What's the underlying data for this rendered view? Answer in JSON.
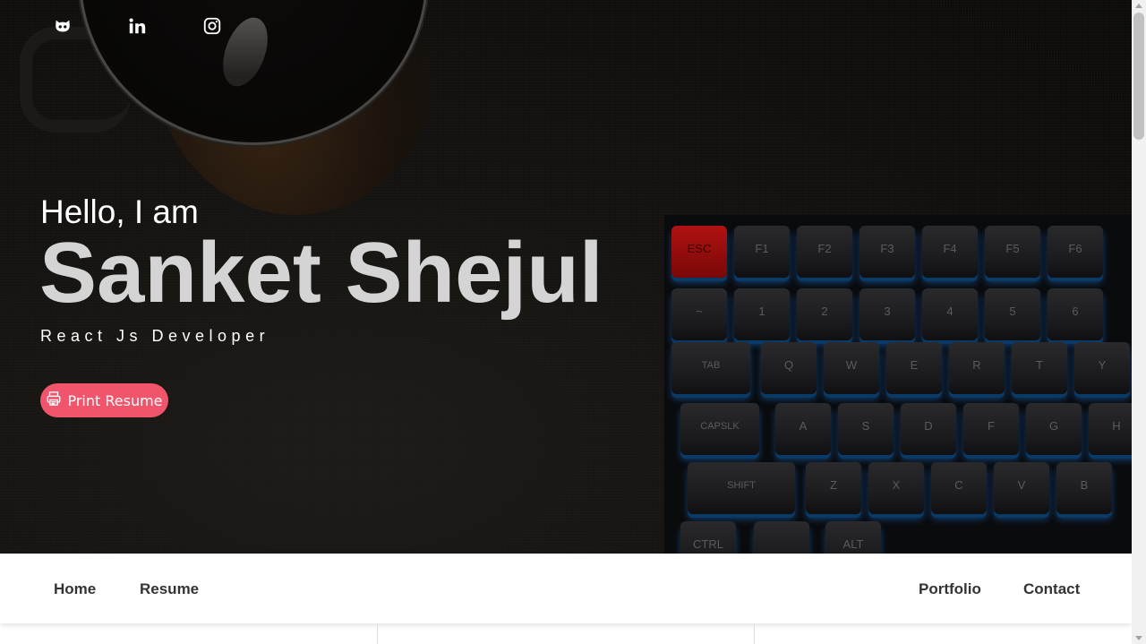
{
  "social": {
    "github": "github-icon",
    "linkedin": "linkedin-icon",
    "instagram": "instagram-icon"
  },
  "hero": {
    "greeting": "Hello, I am",
    "name": "Sanket Shejul",
    "role": "React Js Developer",
    "button_label": "Print Resume",
    "button_icon": "printer-icon"
  },
  "keyboard": {
    "row1": [
      "ESC",
      "F1",
      "F2",
      "F3",
      "F4",
      "F5",
      "F6"
    ],
    "row2": [
      "~",
      "1",
      "2",
      "3",
      "4",
      "5",
      "6"
    ],
    "row3": [
      "TAB",
      "Q",
      "W",
      "E",
      "R",
      "T",
      "Y"
    ],
    "row4": [
      "CAPSLK",
      "A",
      "S",
      "D",
      "F",
      "G",
      "H"
    ],
    "row5": [
      "SHIFT",
      "Z",
      "X",
      "C",
      "V",
      "B"
    ],
    "row6": [
      "CTRL",
      "",
      "ALT"
    ]
  },
  "nav": {
    "home": "Home",
    "resume": "Resume",
    "portfolio": "Portfolio",
    "contact": "Contact"
  },
  "colors": {
    "accent": "#f1556b",
    "name_text": "#d4d4d4"
  }
}
